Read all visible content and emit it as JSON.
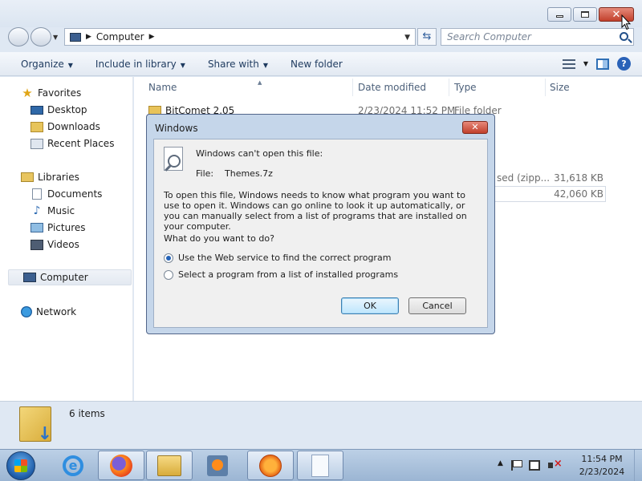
{
  "window": {
    "caption_buttons": [
      "minimize-icon",
      "maximize-icon",
      "close-icon"
    ]
  },
  "navbar": {
    "breadcrumb": "Computer",
    "search_placeholder": "Search Computer"
  },
  "toolbar": {
    "organize": "Organize",
    "include_in_library": "Include in library",
    "share_with": "Share with",
    "new_folder": "New folder"
  },
  "sidebar": {
    "favorites": "Favorites",
    "desktop": "Desktop",
    "downloads": "Downloads",
    "recent_places": "Recent Places",
    "libraries": "Libraries",
    "documents": "Documents",
    "music": "Music",
    "pictures": "Pictures",
    "videos": "Videos",
    "computer": "Computer",
    "network": "Network"
  },
  "columns": {
    "name": "Name",
    "date_modified": "Date modified",
    "type": "Type",
    "size": "Size"
  },
  "files": [
    {
      "name": "BitComet 2.05",
      "date": "2/23/2024 11:52 PM",
      "type": "File folder",
      "size": ""
    },
    {
      "name": "",
      "date": "",
      "type": "sed (zipp...",
      "size": "31,618 KB"
    },
    {
      "name": "",
      "date": "",
      "type": "",
      "size": "42,060 KB"
    }
  ],
  "details": {
    "item_count": "6 items"
  },
  "dialog": {
    "title": "Windows",
    "heading": "Windows can't open this file:",
    "file_label": "File:",
    "file_name": "Themes.7z",
    "explanation": "To open this file, Windows needs to know what program you want to use to open it. Windows can go online to look it up automatically, or you can manually select from a list of programs that are installed on your computer.",
    "question": "What do you want to do?",
    "option_web": "Use the Web service to find the correct program",
    "option_list": "Select a program from a list of installed programs",
    "selected_option": "web",
    "ok": "OK",
    "cancel": "Cancel"
  },
  "taskbar": {
    "apps": [
      "internet-explorer-icon",
      "firefox-icon",
      "windows-explorer-icon",
      "media-player-icon",
      "bitcomet-icon",
      "blank-document-icon"
    ],
    "time": "11:54 PM",
    "date": "2/23/2024"
  }
}
